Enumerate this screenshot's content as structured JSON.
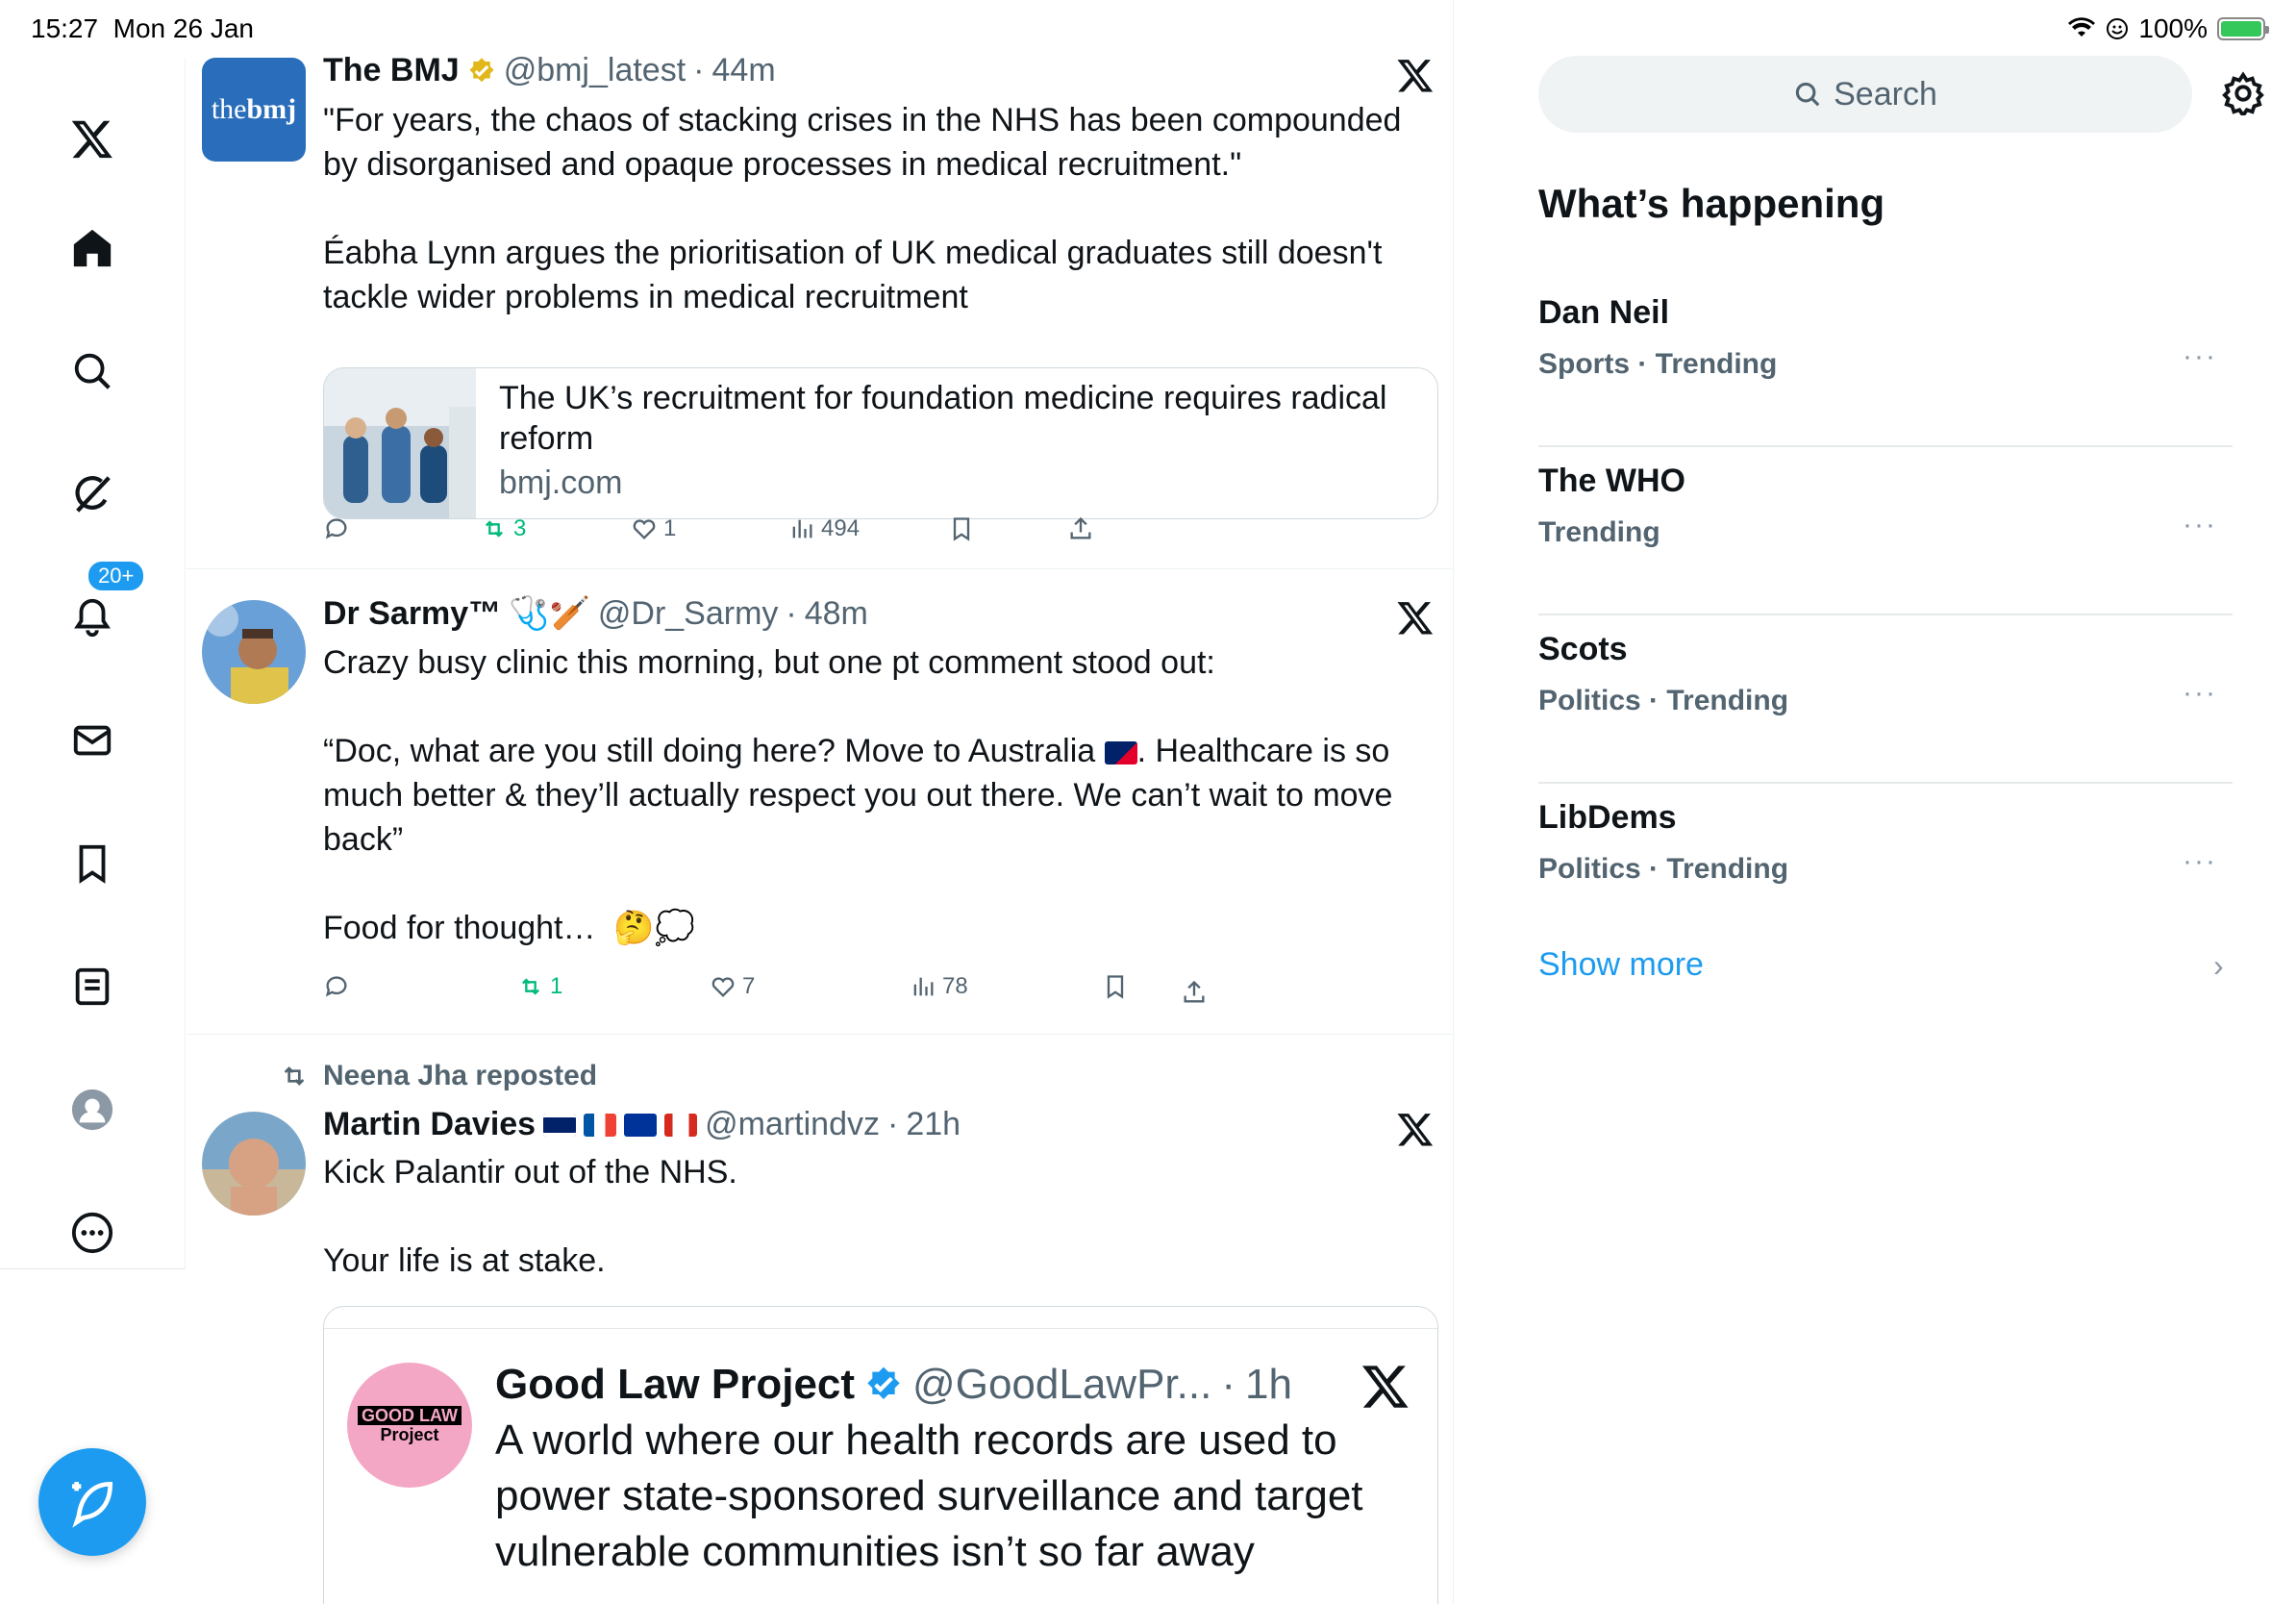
{
  "status_bar": {
    "time": "15:27",
    "date": "Mon 26 Jan",
    "battery": "100%"
  },
  "nav": {
    "items": [
      "x-logo",
      "home",
      "explore",
      "grok",
      "notifications",
      "messages",
      "bookmarks",
      "lists",
      "profile",
      "more"
    ],
    "notifications_badge": "20+"
  },
  "tweets": [
    {
      "name": "The BMJ",
      "handle": "@bmj_latest",
      "sep": "·",
      "time": "44m",
      "avatar_text_a": "the",
      "avatar_text_b": "bmj",
      "body_p1": "\"For years, the chaos of stacking crises in the NHS has been compounded by disorganised and opaque processes in medical recruitment.\"",
      "body_p2": "Éabha Lynn argues the prioritisation of UK medical graduates still doesn't tackle wider problems in medical recruitment",
      "card_title": "The UK’s recruitment for foundation medicine requires radical reform",
      "card_domain": "bmj.com",
      "reposts": "3",
      "likes": "1",
      "views": "494"
    },
    {
      "name": "Dr Sarmy™",
      "name_emoji": "🩺🏏",
      "handle": "@Dr_Sarmy",
      "sep": "·",
      "time": "48m",
      "body_p1": "Crazy busy clinic this morning, but one pt comment stood out:",
      "body_p2_a": "“Doc, what are you still doing here? Move to Australia ",
      "body_p2_b": ". Healthcare is so much better & they’ll actually respect you out there. We can’t wait to move back”",
      "body_p3": "Food for thought…",
      "body_p3_emoji": "🤔💭",
      "reposts": "1",
      "likes": "7",
      "views": "78"
    },
    {
      "repost_label": "Neena Jha reposted",
      "name": "Martin Davies",
      "handle": "@martindvz",
      "sep": "·",
      "time": "21h",
      "body_p1": "Kick Palantir out of the NHS.",
      "body_p2": "Your life is at stake.",
      "quote": {
        "name": "Good Law Project",
        "handle": "@GoodLawPr...",
        "sep": "·",
        "time": "1h",
        "avatar_line1": "GOOD LAW",
        "avatar_line2": "Project",
        "body": "A world where our health records are used to power state-sponsored surveillance and target vulnerable communities isn’t so far away"
      }
    }
  ],
  "sidebar": {
    "search_placeholder": "Search",
    "title": "What’s happening",
    "trends": [
      {
        "name": "Dan Neil",
        "meta": "Sports · Trending"
      },
      {
        "name": "The WHO",
        "meta": "Trending"
      },
      {
        "name": "Scots",
        "meta": "Politics · Trending"
      },
      {
        "name": "LibDems",
        "meta": "Politics · Trending"
      }
    ],
    "more_dots": "···",
    "show_more": "Show more",
    "chevron": "›"
  },
  "colors": {
    "accent": "#1d9bf0",
    "repost_green": "#00ba7c",
    "text_secondary": "#536471",
    "bmj_blue": "#2a6ebb",
    "glp_pink": "#f4a7c4"
  }
}
